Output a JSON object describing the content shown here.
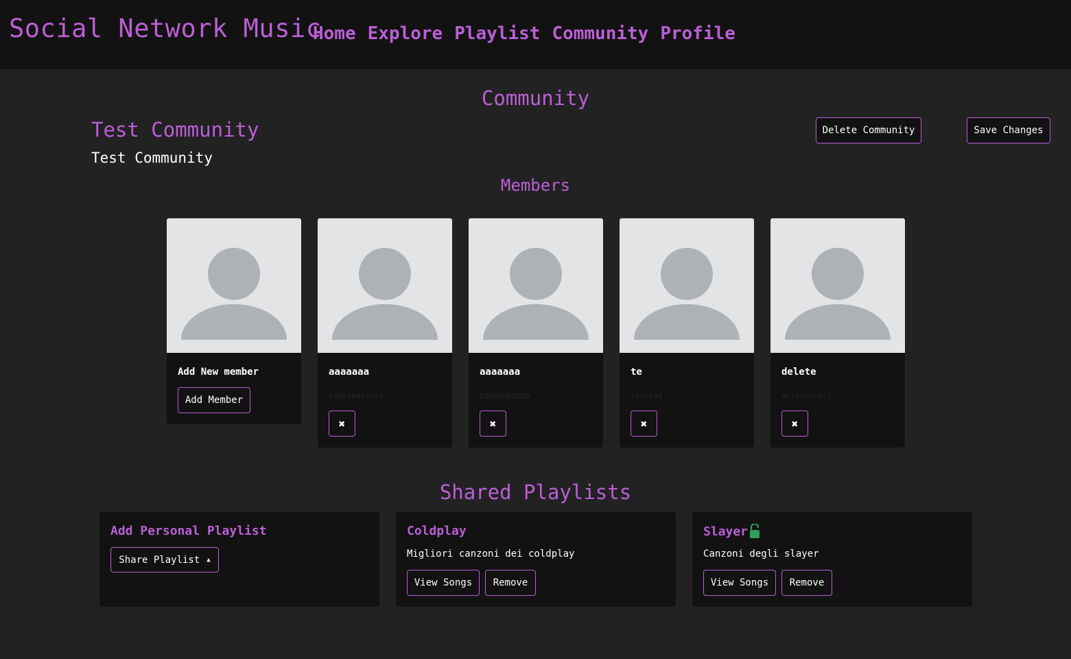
{
  "navbar": {
    "brand": "Social Network Music",
    "links": [
      "Home",
      "Explore",
      "Playlist",
      "Community",
      "Profile"
    ]
  },
  "page": {
    "title": "Community",
    "community_name": "Test Community",
    "community_description": "Test Community",
    "delete_button": "Delete Community",
    "save_button": "Save Changes"
  },
  "members": {
    "title": "Members",
    "add_card": {
      "label": "Add New member",
      "button": "Add Member"
    },
    "list": [
      {
        "name": "aaaaaaa",
        "username": "aaaaaaaaaaaa",
        "remove_icon": "✖"
      },
      {
        "name": "aaaaaaa",
        "username": "bbbbbbbbbbb",
        "remove_icon": "✖"
      },
      {
        "name": "te",
        "username": "testing",
        "remove_icon": "✖"
      },
      {
        "name": "delete",
        "username": "deleteuser2",
        "remove_icon": "✖"
      }
    ]
  },
  "playlists": {
    "title": "Shared Playlists",
    "add_card": {
      "title": "Add Personal Playlist",
      "button": "Share Playlist"
    },
    "list": [
      {
        "name": "Coldplay",
        "description": "Migliori canzoni dei coldplay",
        "view_button": "View Songs",
        "remove_button": "Remove",
        "unlocked": false
      },
      {
        "name": "Slayer",
        "description": "Canzoni degli slayer",
        "view_button": "View Songs",
        "remove_button": "Remove",
        "unlocked": true
      }
    ]
  },
  "colors": {
    "accent": "#bb5fd6",
    "background": "#222222",
    "navbar": "#121212",
    "card": "#121212",
    "lock": "#2e9e5b"
  }
}
